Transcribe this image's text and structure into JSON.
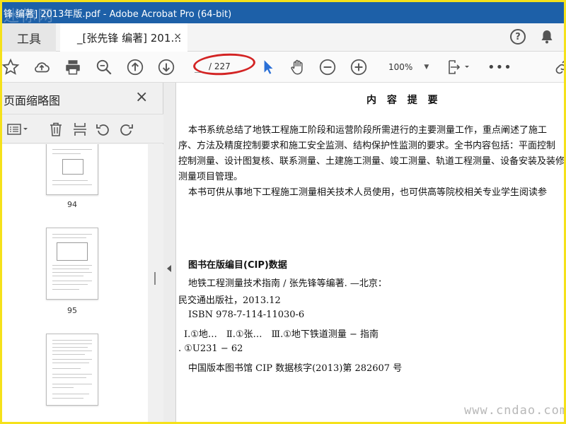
{
  "window": {
    "title": "锋 编著] 2013年版.pdf - Adobe Acrobat Pro (64-bit)",
    "watermark": "迷你网"
  },
  "tabs": {
    "tools_label": "工具",
    "doc_label": "_[张先锋 编著] 201…",
    "close_glyph": "×"
  },
  "toolbar": {
    "page_total": "/ 227",
    "zoom": "100%"
  },
  "sidebar": {
    "title": "页面缩略图",
    "close_glyph": "×",
    "thumbnails": [
      {
        "label": "94"
      },
      {
        "label": "95"
      },
      {
        "label": ""
      }
    ]
  },
  "document": {
    "heading": "内 容 提 要",
    "para1_line1": "本书系统总结了地铁工程施工阶段和运营阶段所需进行的主要测量工作，重点阐述了施工",
    "para1_line2": "序、方法及精度控制要求和施工安全监测、结构保护性监测的要求。全书内容包括：平面控制",
    "para1_line3": "控制测量、设计图复核、联系测量、土建施工测量、竣工测量、轨道工程测量、设备安装及装修测",
    "para1_line4": "测量项目管理。",
    "para2_line1": "本书可供从事地下工程施工测量相关技术人员使用，也可供高等院校相关专业学生阅读参",
    "cip_heading": "图书在版编目(CIP)数据",
    "cip_line1": "地铁工程测量技术指南 / 张先锋等编著. —北京：",
    "cip_line2": "民交通出版社，2013.12",
    "cip_line3": "ISBN 978-7-114-11030-6",
    "cip_line4": "Ⅰ.①地…　Ⅱ.①张…　Ⅲ.①地下铁道测量 − 指南",
    "cip_line5": ". ①U231 − 62",
    "cip_line6": "中国版本图书馆 CIP 数据核字(2013)第 282607 号"
  },
  "site_watermark": "www.cndao.com",
  "colors": {
    "titlebar": "#1d60a8",
    "highlight_oval": "#d32424",
    "select_arrow": "#2a6fd6",
    "outer_border": "#f5e11a"
  }
}
